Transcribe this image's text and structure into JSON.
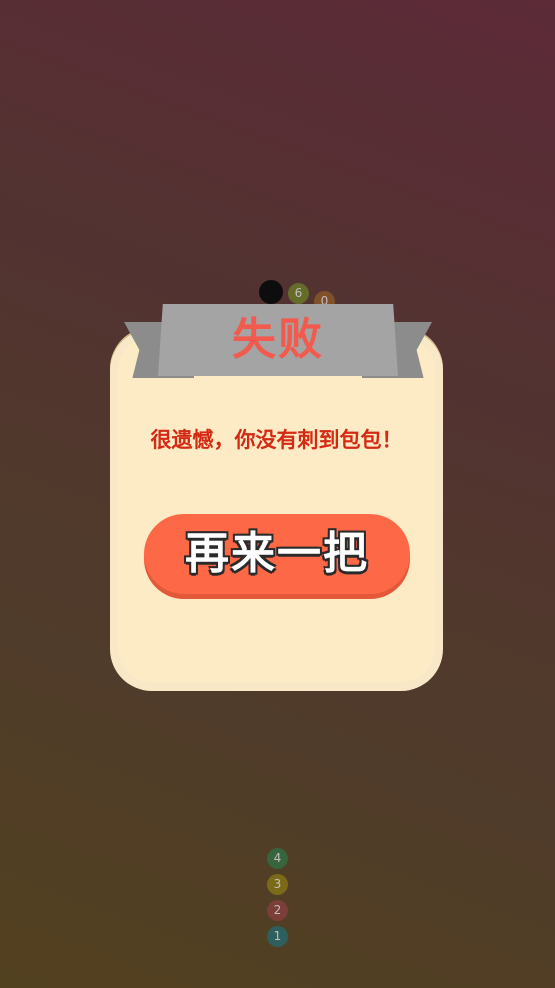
{
  "game": {
    "top_balls": [
      {
        "label": "6",
        "color": "#6c7f25"
      },
      {
        "label": "0",
        "color": "#8f5a27"
      }
    ],
    "bottom_balls": [
      {
        "label": "4",
        "color": "#2f7245"
      },
      {
        "label": "3",
        "color": "#8a7a14"
      },
      {
        "label": "2",
        "color": "#8a3f3f"
      },
      {
        "label": "1",
        "color": "#226a72"
      }
    ]
  },
  "dialog": {
    "title": "失败",
    "message": "很遗憾，你没有刺到包包！",
    "retry_label": "再来一把"
  },
  "colors": {
    "title": "#f25a4e",
    "message": "#d42a14",
    "button": "#fd6847",
    "panel": "#fdebc6"
  }
}
